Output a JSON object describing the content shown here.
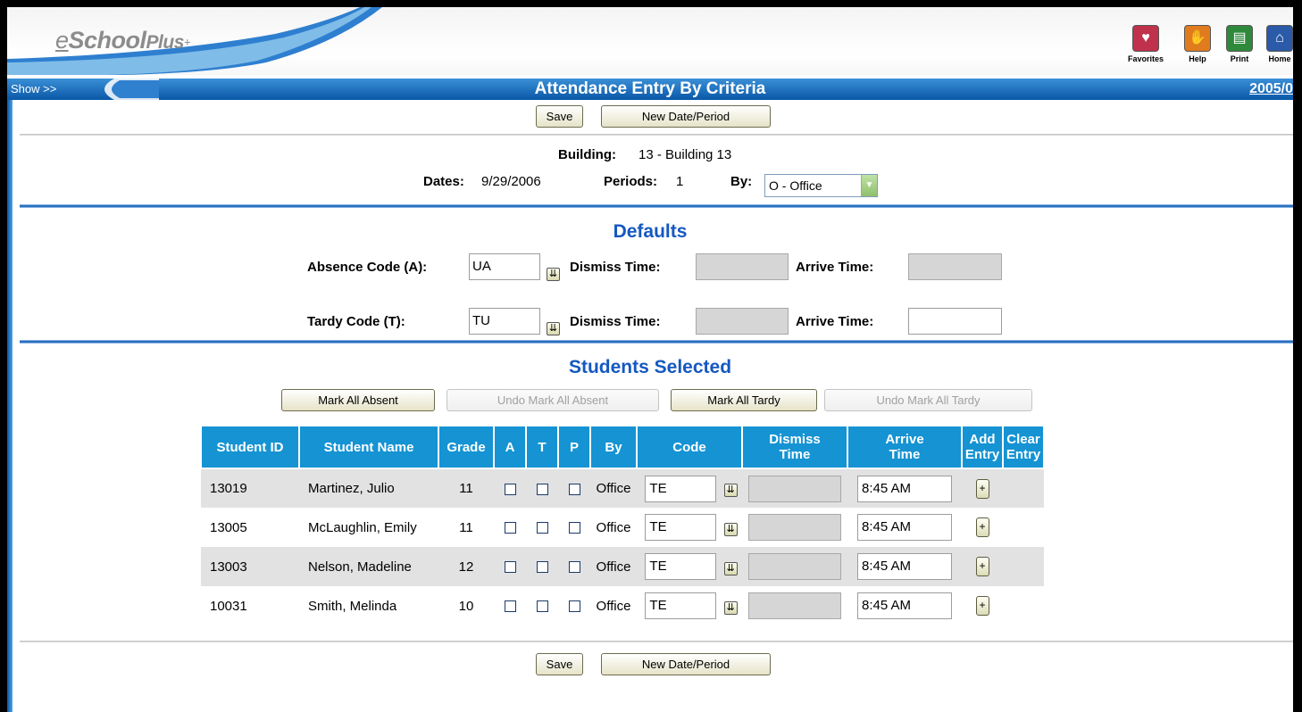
{
  "app": {
    "logo": {
      "e": "e",
      "school": "School",
      "plus": "Plus",
      "plus_sign": "+"
    },
    "top_icons": [
      {
        "label": "Favorites",
        "icon": "heart-icon",
        "color": "#c0314c"
      },
      {
        "label": "Help",
        "icon": "hand-icon",
        "color": "#e07b1e"
      },
      {
        "label": "Print",
        "icon": "printer-icon",
        "color": "#2e8a3a"
      },
      {
        "label": "Home",
        "icon": "home-icon",
        "color": "#2a5aa8"
      }
    ]
  },
  "titlebar": {
    "show_label": "Show >>",
    "title": "Attendance Entry By Criteria",
    "school_year": "2005/0"
  },
  "buttons": {
    "save": "Save",
    "new_date_period": "New Date/Period",
    "mark_all_absent": "Mark All Absent",
    "undo_mark_all_absent": "Undo Mark All Absent",
    "mark_all_tardy": "Mark All Tardy",
    "undo_mark_all_tardy": "Undo Mark All Tardy"
  },
  "info": {
    "building_label": "Building:",
    "building_value": "13 - Building 13",
    "dates_label": "Dates:",
    "dates_value": "9/29/2006",
    "periods_label": "Periods:",
    "periods_value": "1",
    "by_label": "By:",
    "by_value": "O - Office"
  },
  "defaults": {
    "heading": "Defaults",
    "absence_code_label": "Absence Code (A):",
    "absence_code_value": "UA",
    "tardy_code_label": "Tardy Code (T):",
    "tardy_code_value": "TU",
    "dismiss_time_label": "Dismiss Time:",
    "arrive_time_label": "Arrive Time:"
  },
  "students": {
    "heading": "Students Selected",
    "columns": [
      "Student ID",
      "Student Name",
      "Grade",
      "A",
      "T",
      "P",
      "By",
      "Code",
      "Dismiss Time",
      "Arrive Time",
      "Add Entry",
      "Clear Entry"
    ],
    "columns_split": {
      "dismiss": [
        "Dismiss",
        "Time"
      ],
      "arrive": [
        "Arrive",
        "Time"
      ],
      "add": [
        "Add",
        "Entry"
      ],
      "clear": [
        "Clear",
        "Entry"
      ]
    },
    "rows": [
      {
        "id": "13019",
        "name": "Martinez, Julio",
        "grade": "11",
        "by": "Office",
        "code": "TE",
        "arrive": "8:45 AM",
        "add": "+"
      },
      {
        "id": "13005",
        "name": "McLaughlin, Emily",
        "grade": "11",
        "by": "Office",
        "code": "TE",
        "arrive": "8:45 AM",
        "add": "+"
      },
      {
        "id": "13003",
        "name": "Nelson, Madeline",
        "grade": "12",
        "by": "Office",
        "code": "TE",
        "arrive": "8:45 AM",
        "add": "+"
      },
      {
        "id": "10031",
        "name": "Smith, Melinda",
        "grade": "10",
        "by": "Office",
        "code": "TE",
        "arrive": "8:45 AM",
        "add": "+"
      }
    ]
  },
  "glyphs": {
    "dropdown": "⇊",
    "select_arrow": "▼"
  }
}
